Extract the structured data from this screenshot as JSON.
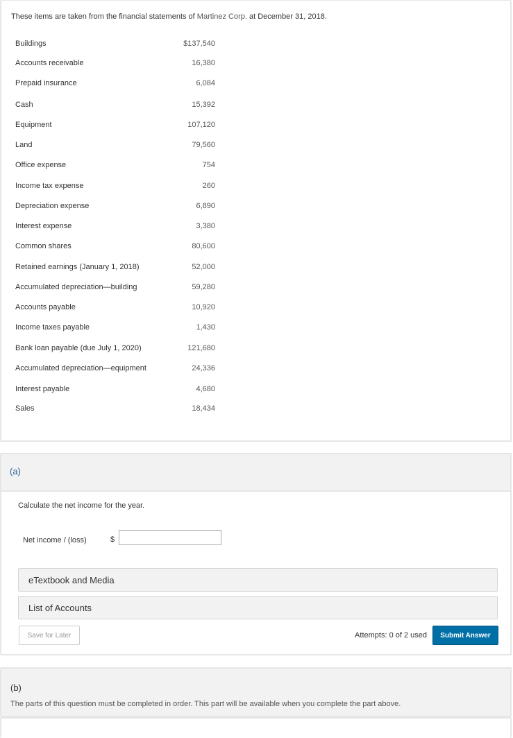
{
  "intro": {
    "text_prefix": "These items are taken from the financial statements of ",
    "company": "Martinez Corp.",
    "text_suffix": " at December 31, 2018."
  },
  "items": [
    {
      "label": "Buildings",
      "value": "$137,540"
    },
    {
      "label": "Accounts receivable",
      "value": "16,380"
    },
    {
      "label": "Prepaid insurance",
      "value": "6,084"
    },
    {
      "label": "Cash",
      "value": "15,392"
    },
    {
      "label": "Equipment",
      "value": "107,120"
    },
    {
      "label": "Land",
      "value": "79,560"
    },
    {
      "label": "Office expense",
      "value": "754"
    },
    {
      "label": "Income tax expense",
      "value": "260"
    },
    {
      "label": "Depreciation expense",
      "value": "6,890"
    },
    {
      "label": "Interest expense",
      "value": "3,380"
    },
    {
      "label": "Common shares",
      "value": "80,600"
    },
    {
      "label": "Retained earnings (January 1, 2018)",
      "value": "52,000"
    },
    {
      "label": "Accumulated depreciation—building",
      "value": "59,280"
    },
    {
      "label": "Accounts payable",
      "value": "10,920"
    },
    {
      "label": "Income taxes payable",
      "value": "1,430"
    },
    {
      "label": "Bank loan payable  (due July 1, 2020)",
      "value": "121,680"
    },
    {
      "label": "Accumulated depreciation—equipment",
      "value": "24,336"
    },
    {
      "label": "Interest payable",
      "value": "4,680"
    },
    {
      "label": "Sales",
      "value": "18,434"
    }
  ],
  "part_a": {
    "label": "(a)",
    "question": "Calculate the net income for the year.",
    "net_income_label": "Net income / (loss)",
    "currency": "$",
    "net_income_value": "",
    "etextbook": "eTextbook and Media",
    "list_of_accounts": "List of Accounts",
    "save_label": "Save for Later",
    "attempts": "Attempts: 0 of 2 used",
    "submit_label": "Submit Answer"
  },
  "part_b": {
    "label": "(b)",
    "note": "The parts of this question must be completed in order. This part will be available when you complete the part above."
  },
  "colors": {
    "submit_bg": "#006fa6",
    "part_a_label": "#2a6496",
    "panel_bg": "#f2f2f2"
  }
}
